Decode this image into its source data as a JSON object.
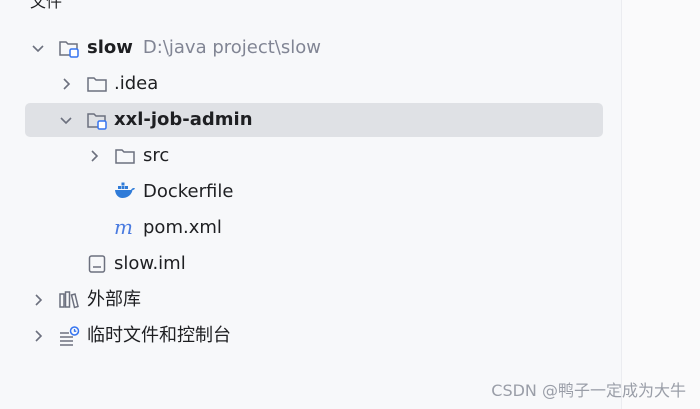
{
  "header": {
    "title_fragment": "文件"
  },
  "tree": {
    "root": {
      "name": "slow",
      "path": "D:\\java project\\slow"
    },
    "idea": {
      "name": ".idea"
    },
    "module": {
      "name": "xxl-job-admin"
    },
    "src": {
      "name": "src"
    },
    "dockerfile": {
      "name": "Dockerfile"
    },
    "pom": {
      "name": "pom.xml"
    },
    "iml": {
      "name": "slow.iml"
    },
    "external": {
      "name": "外部库"
    },
    "scratches": {
      "name": "临时文件和控制台"
    }
  },
  "watermark": "CSDN @鸭子一定成为大牛",
  "colors": {
    "selection": "#dfe1e5",
    "module_badge": "#3574f0",
    "docker_blue": "#2f7bd8",
    "maven_blue": "#4a7be0"
  },
  "icons": [
    "chevron-down-icon",
    "chevron-right-icon",
    "module-folder-icon",
    "folder-icon",
    "docker-icon",
    "maven-icon",
    "iml-file-icon",
    "library-icon",
    "scratches-icon"
  ]
}
